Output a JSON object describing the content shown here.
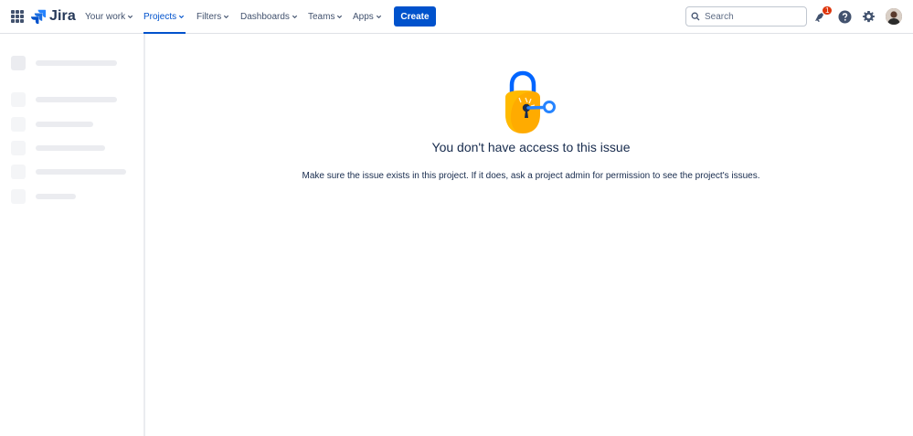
{
  "nav": {
    "logo_text": "Jira",
    "items": [
      {
        "label": "Your work"
      },
      {
        "label": "Projects"
      },
      {
        "label": "Filters"
      },
      {
        "label": "Dashboards"
      },
      {
        "label": "Teams"
      },
      {
        "label": "Apps"
      }
    ],
    "active_item": "Projects",
    "create_label": "Create",
    "search_placeholder": "Search",
    "notification_count": "1",
    "accent_color": "#0052cc",
    "badge_color": "#de350b",
    "icons": [
      "app-switcher-icon",
      "jira-logo-icon",
      "search-icon",
      "notifications-icon",
      "help-icon",
      "settings-icon",
      "avatar"
    ]
  },
  "main": {
    "illustration": "padlock-with-key",
    "title": "You don't have access to this issue",
    "message": "Make sure the issue exists in this project. If it does, ask a project admin for permission to see the project's issues."
  }
}
